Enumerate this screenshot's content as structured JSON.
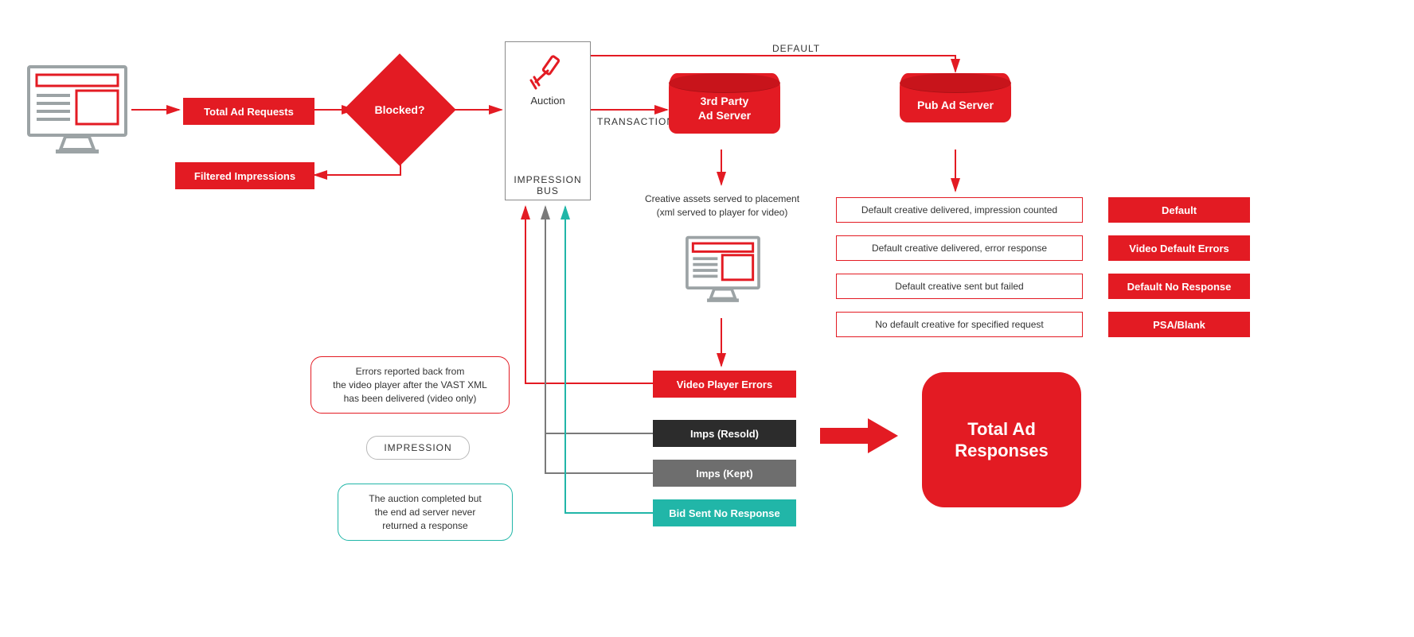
{
  "labels": {
    "totalAdRequests": "Total Ad Requests",
    "blocked": "Blocked?",
    "filteredImpressions": "Filtered Impressions",
    "auction": "Auction",
    "impressionBus": "IMPRESSION BUS",
    "transaction": "TRANSACTION",
    "default": "DEFAULT",
    "thirdPartyAdServer": "3rd Party\nAd Server",
    "pubAdServer": "Pub Ad Server",
    "creativeNote": "Creative assets served to placement\n(xml served to player for video)",
    "videoPlayerErrors": "Video Player Errors",
    "impsResold": "Imps (Resold)",
    "impsKept": "Imps (Kept)",
    "bidSentNoResponse": "Bid Sent No Response",
    "noteErrors": "Errors reported back from\nthe video player after the VAST XML\nhas been delivered (video only)",
    "impression": "IMPRESSION",
    "noteAuctionComplete": "The auction completed but\nthe end ad server never\nreturned a response",
    "defaultDeliveredCounted": "Default creative delivered, impression counted",
    "defaultDeliveredError": "Default creative delivered, error response",
    "defaultSentFailed": "Default creative sent but failed",
    "noDefaultCreative": "No default creative for specified request",
    "defaultTag": "Default",
    "videoDefaultErrors": "Video Default Errors",
    "defaultNoResponse": "Default No Response",
    "psaBlank": "PSA/Blank",
    "totalAdResponses": "Total Ad\nResponses"
  },
  "colors": {
    "red": "#E31B23",
    "dark": "#2c2c2c",
    "gray": "#6e6e6e",
    "teal": "#21B6A8"
  }
}
